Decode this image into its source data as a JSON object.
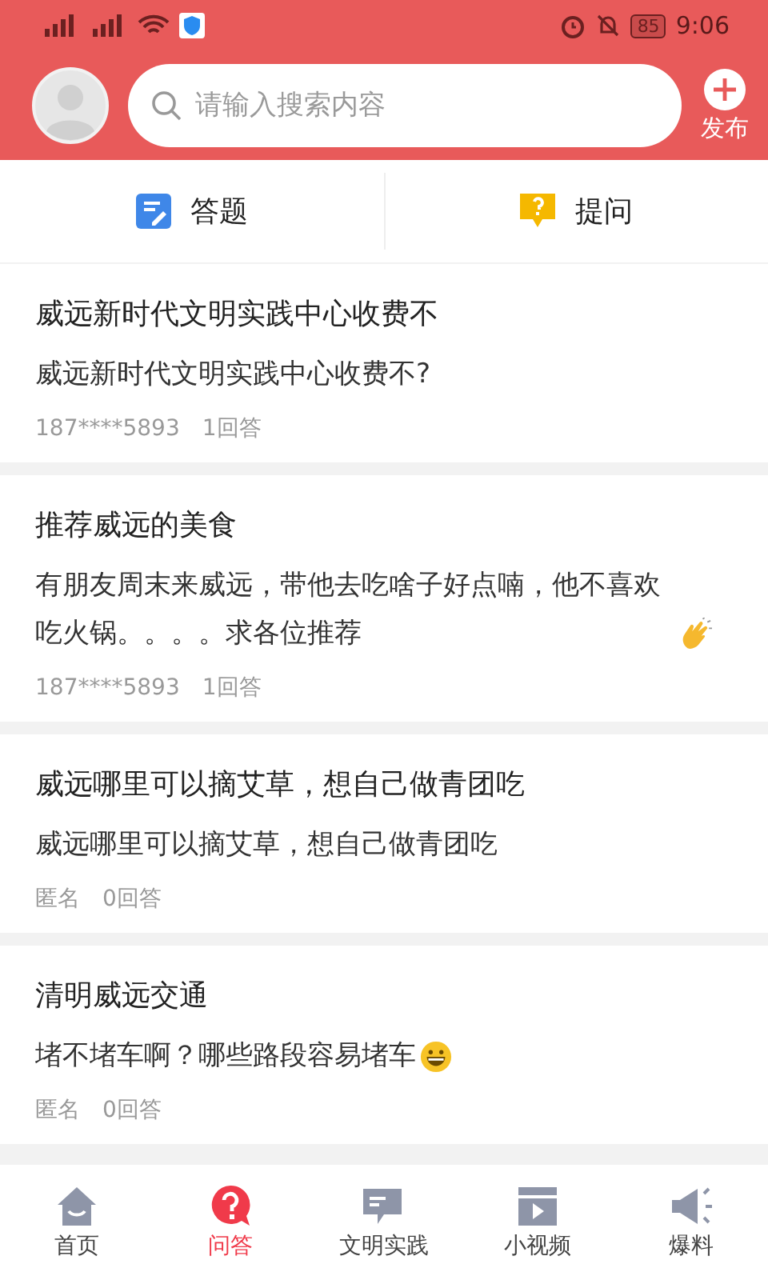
{
  "status_bar": {
    "battery": "85",
    "time": "9:06"
  },
  "header": {
    "search": {
      "placeholder": "请输入搜索内容"
    },
    "publish_label": "发布"
  },
  "tabs": [
    {
      "label": "答题",
      "kind": "answer"
    },
    {
      "label": "提问",
      "kind": "ask"
    }
  ],
  "questions": [
    {
      "title": "威远新时代文明实践中心收费不",
      "excerpt": "威远新时代文明实践中心收费不?",
      "kind": "plain",
      "author": "187****5893",
      "answers": "1回答"
    },
    {
      "title": "推荐威远的美食",
      "excerpt": "有朋友周末来威远，带他去吃啥子好点喃，他不喜欢吃火锅。。。。求各位推荐",
      "kind": "clap",
      "author": "187****5893",
      "answers": "1回答"
    },
    {
      "title": "威远哪里可以摘艾草，想自己做青团吃",
      "excerpt": "威远哪里可以摘艾草，想自己做青团吃",
      "kind": "plain",
      "author": "匿名",
      "answers": "0回答"
    },
    {
      "title": "清明威远交通",
      "excerpt": "堵不堵车啊？哪些路段容易堵车",
      "kind": "grin",
      "author": "匿名",
      "answers": "0回答"
    }
  ],
  "bottom_nav": [
    {
      "label": "首页",
      "kind": "home",
      "selected": false
    },
    {
      "label": "问答",
      "kind": "qa",
      "selected": true
    },
    {
      "label": "文明实践",
      "kind": "practice",
      "selected": false
    },
    {
      "label": "小视频",
      "kind": "video",
      "selected": false
    },
    {
      "label": "爆料",
      "kind": "megaphone",
      "selected": false
    }
  ]
}
